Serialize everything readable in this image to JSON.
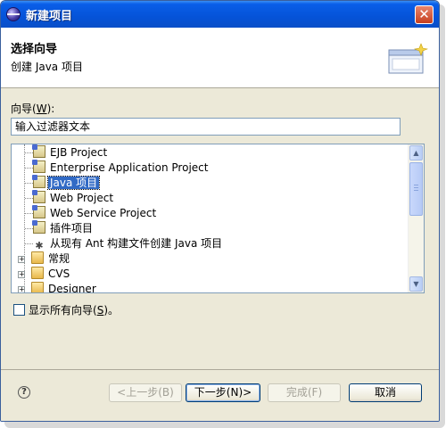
{
  "window": {
    "title": "新建项目"
  },
  "header": {
    "title": "选择向导",
    "description": "创建 Java 项目"
  },
  "wizard": {
    "label_prefix": "向导(",
    "label_mnemonic": "W",
    "label_suffix": "):",
    "filter_text": "输入过滤器文本"
  },
  "tree": {
    "items": [
      {
        "label": "EJB Project",
        "icon": "ejb-project-icon"
      },
      {
        "label": "Enterprise Application Project",
        "icon": "enterprise-project-icon"
      },
      {
        "label": "Java 项目",
        "icon": "java-project-icon",
        "selected": true
      },
      {
        "label": "Web Project",
        "icon": "web-project-icon"
      },
      {
        "label": "Web Service Project",
        "icon": "web-service-project-icon"
      },
      {
        "label": "插件项目",
        "icon": "plugin-project-icon"
      },
      {
        "label": "从现有 Ant 构建文件创建 Java 项目",
        "icon": "ant-icon"
      }
    ],
    "folders": [
      {
        "label": "常规",
        "expander": "+"
      },
      {
        "label": "CVS",
        "expander": "+"
      },
      {
        "label": "Designer",
        "expander": "+"
      }
    ]
  },
  "show_all": {
    "label_prefix": "显示所有向导(",
    "label_mnemonic": "S",
    "label_suffix": ")。",
    "checked": false
  },
  "footer": {
    "help": "?",
    "back": "<上一步(B)",
    "next": "下一步(N)>",
    "finish": "完成(F)",
    "cancel": "取消"
  },
  "colors": {
    "title_bar": "#0553d8",
    "selection": "#316ac5",
    "close": "#c73f1e"
  }
}
